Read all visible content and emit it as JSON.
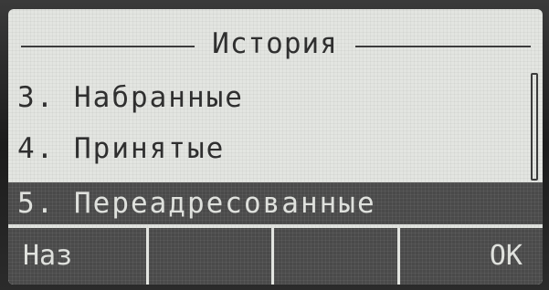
{
  "header": {
    "title": "История"
  },
  "menu": {
    "items": [
      {
        "label": "3. Набранные",
        "selected": false
      },
      {
        "label": "4. Принятые",
        "selected": false
      },
      {
        "label": "5. Переадресованные",
        "selected": true
      }
    ]
  },
  "softkeys": {
    "key1": "Наз",
    "key2": "",
    "key3": "",
    "key4": "OK"
  },
  "colors": {
    "screen_background": "#e3e5e1",
    "highlight_background": "#4a4a4a",
    "text": "#2f2f2f",
    "highlight_text": "#dfe1dd"
  }
}
